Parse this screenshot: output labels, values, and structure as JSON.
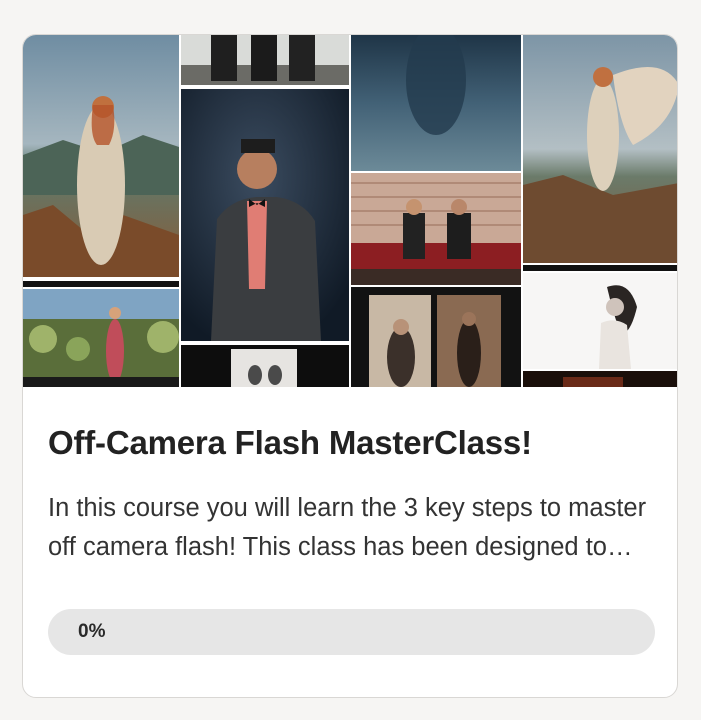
{
  "course": {
    "title": "Off-Camera Flash MasterClass!",
    "description": "In this course you will learn the 3 key steps to master off camera flash! This class has been designed to take you from beginner to advanced in off camera flash photography.",
    "progress_label": "0%",
    "progress_fraction": 0
  },
  "thumbnail": {
    "photos": [
      "bride-mountain-photo",
      "cactus-dress-photo",
      "groomsmen-photo",
      "man-bowtie-photo",
      "portrait-closeup-photo",
      "misty-figure-photo",
      "couple-sofa-photo",
      "two-women-photo",
      "flowing-gown-photo",
      "woman-white-backdrop-photo",
      "strip-photo"
    ]
  }
}
